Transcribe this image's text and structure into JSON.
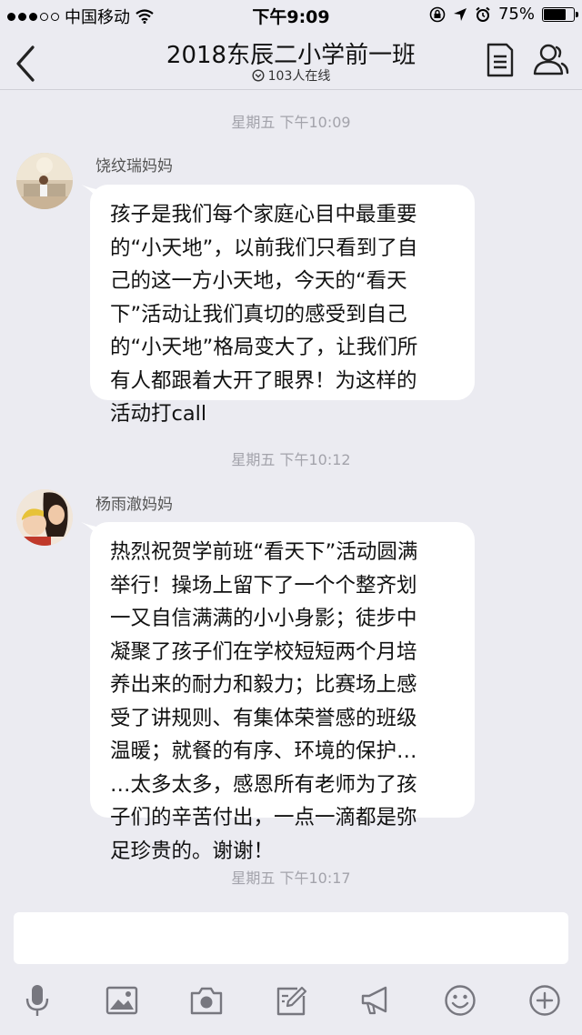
{
  "status_bar": {
    "carrier": "中国移动",
    "time": "下午9:09",
    "battery_text": "75%",
    "battery_level": 0.75
  },
  "header": {
    "title": "2018东辰二小学前一班",
    "online": "103人在线"
  },
  "messages": [
    {
      "timestamp": "星期五 下午10:09",
      "sender": "饶纹瑞妈妈",
      "lines": [
        "孩子是我们每个家庭心目中最重要",
        "的“小天地”，以前我们只看到了自",
        "己的这一方小天地，今天的“看天",
        "下”活动让我们真切的感受到自己",
        "的“小天地”格局变大了，让我们所",
        "有人都跟着大开了眼界！为这样的",
        "活动打call"
      ]
    },
    {
      "timestamp": "星期五 下午10:12",
      "sender": "杨雨澈妈妈",
      "lines": [
        "热烈祝贺学前班“看天下”活动圆满",
        "举行！操场上留下了一个个整齐划",
        "一又自信满满的小小身影；徒步中",
        "凝聚了孩子们在学校短短两个月培",
        "养出来的耐力和毅力；比赛场上感",
        "受了讲规则、有集体荣誉感的班级",
        "温暖；就餐的有序、环境的保护…",
        "…太多太多，感恩所有老师为了孩",
        "子们的辛苦付出，一点一滴都是弥",
        "足珍贵的。谢谢！"
      ]
    }
  ],
  "last_timestamp": "星期五 下午10:17",
  "input": {
    "placeholder": ""
  },
  "toolbar_icons": [
    "microphone-icon",
    "image-icon",
    "camera-icon",
    "edit-icon",
    "megaphone-icon",
    "emoji-icon",
    "plus-icon"
  ]
}
